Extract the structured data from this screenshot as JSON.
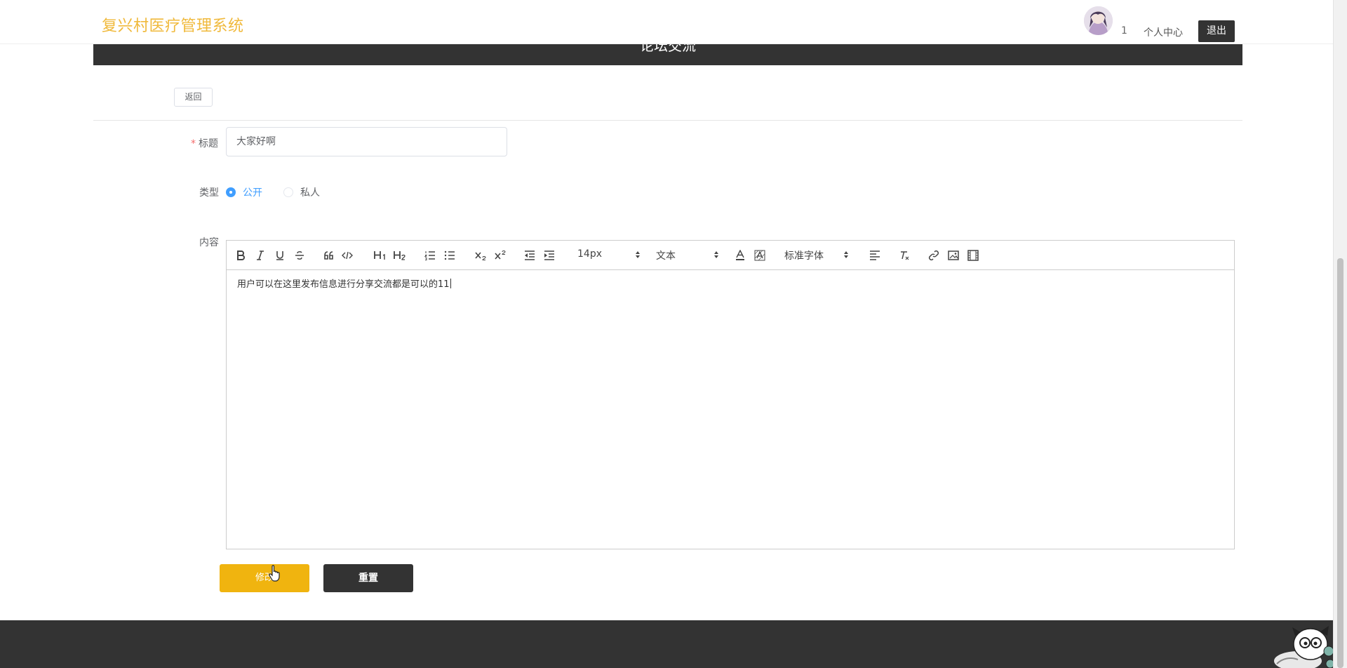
{
  "header": {
    "brand": "复兴村医疗管理系统",
    "user_id": "1",
    "user_center_label": "个人中心",
    "logout_label": "退出"
  },
  "banner": {
    "title": "论坛交流"
  },
  "back_label": "返回",
  "form": {
    "title_label": "标题",
    "title_required_mark": "*",
    "title_value": "大家好啊",
    "type_label": "类型",
    "type_options": [
      "公开",
      "私人"
    ],
    "type_selected": "公开",
    "content_label": "内容"
  },
  "editor": {
    "size_picker": "14px",
    "header_picker": "文本",
    "font_picker": "标准字体",
    "content_text": "用户可以在这里发布信息进行分享交流都是可以的11"
  },
  "buttons": {
    "submit_label": "修改",
    "reset_label": "重置"
  },
  "colors": {
    "brand": "#f0b93b",
    "dark": "#333333",
    "accent_yellow": "#f0b40f",
    "radio_blue": "#409eff"
  }
}
